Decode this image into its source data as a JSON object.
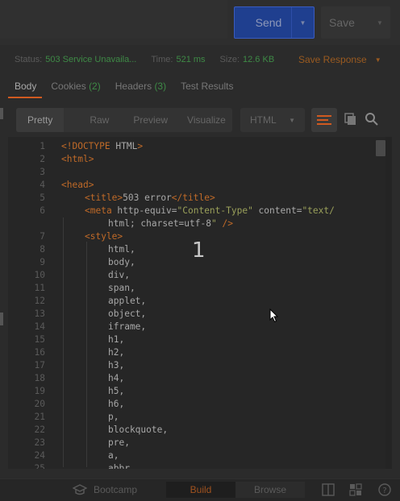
{
  "request": {
    "send_label": "Send",
    "save_label": "Save"
  },
  "status": {
    "status_label": "Status:",
    "status_value": "503 Service Unavaila...",
    "time_label": "Time:",
    "time_value": "521 ms",
    "size_label": "Size:",
    "size_value": "12.6 KB",
    "save_response_label": "Save Response"
  },
  "tabs": [
    {
      "label": "Body",
      "count": ""
    },
    {
      "label": "Cookies",
      "count": "(2)"
    },
    {
      "label": "Headers",
      "count": "(3)"
    },
    {
      "label": "Test Results",
      "count": ""
    }
  ],
  "view": {
    "modes": [
      "Pretty",
      "Raw",
      "Preview",
      "Visualize"
    ],
    "format": "HTML"
  },
  "code_lines": [
    {
      "n": "1",
      "text": "<!DOCTYPE HTML>"
    },
    {
      "n": "2",
      "text": "<html>"
    },
    {
      "n": "3",
      "text": ""
    },
    {
      "n": "4",
      "text": "<head>"
    },
    {
      "n": "5",
      "text": "<title>503 error</title>"
    },
    {
      "n": "6",
      "text": "<meta http-equiv=\"Content-Type\" content=\"text/"
    },
    {
      "n": "",
      "text": "html; charset=utf-8\" />"
    },
    {
      "n": "7",
      "text": "<style>"
    },
    {
      "n": "8",
      "text": "html,"
    },
    {
      "n": "9",
      "text": "body,"
    },
    {
      "n": "10",
      "text": "div,"
    },
    {
      "n": "11",
      "text": "span,"
    },
    {
      "n": "12",
      "text": "applet,"
    },
    {
      "n": "13",
      "text": "object,"
    },
    {
      "n": "14",
      "text": "iframe,"
    },
    {
      "n": "15",
      "text": "h1,"
    },
    {
      "n": "16",
      "text": "h2,"
    },
    {
      "n": "17",
      "text": "h3,"
    },
    {
      "n": "18",
      "text": "h4,"
    },
    {
      "n": "19",
      "text": "h5,"
    },
    {
      "n": "20",
      "text": "h6,"
    },
    {
      "n": "21",
      "text": "p,"
    },
    {
      "n": "22",
      "text": "blockquote,"
    },
    {
      "n": "23",
      "text": "pre,"
    },
    {
      "n": "24",
      "text": "a,"
    },
    {
      "n": "25",
      "text": "abbr,"
    }
  ],
  "overlay_number": "1",
  "bottom": {
    "bootcamp_label": "Bootcamp",
    "build_label": "Build",
    "browse_label": "Browse"
  },
  "colors": {
    "accent": "#d05a20",
    "send_button": "#1f3f8f",
    "status_ok_green": "#3e8a46",
    "tag": "#c06a28",
    "string": "#9aa05a"
  },
  "icons": [
    "copy-icon",
    "search-icon",
    "wrap-lines-icon",
    "bootcamp-icon",
    "two-pane-icon",
    "layout-icon",
    "help-icon",
    "mouse-cursor-icon"
  ]
}
